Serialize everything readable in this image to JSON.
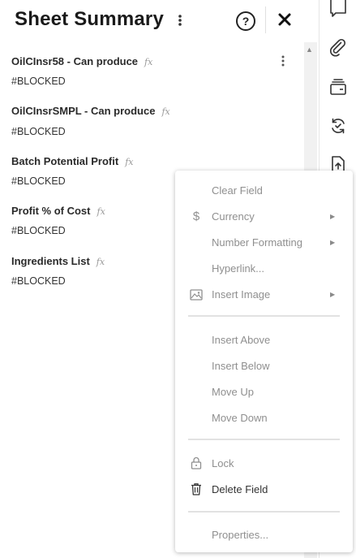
{
  "panel": {
    "title": "Sheet Summary",
    "help_glyph": "?",
    "fields": [
      {
        "label": "OilCInsr58 - Can produce",
        "value": "#BLOCKED",
        "fx": "fx"
      },
      {
        "label": "OilCInsrSMPL - Can produce",
        "value": "#BLOCKED",
        "fx": "fx"
      },
      {
        "label": "Batch Potential Profit",
        "value": "#BLOCKED",
        "fx": "fx"
      },
      {
        "label": "Profit % of Cost",
        "value": "#BLOCKED",
        "fx": "fx"
      },
      {
        "label": "Ingredients List",
        "value": "#BLOCKED",
        "fx": "fx"
      }
    ]
  },
  "rail": {
    "icons": [
      "comment-icon",
      "attachment-icon",
      "layers-icon",
      "sync-icon",
      "upload-icon"
    ]
  },
  "context_menu": {
    "items": {
      "clear_field": "Clear Field",
      "currency": "Currency",
      "number_formatting": "Number Formatting",
      "hyperlink": "Hyperlink...",
      "insert_image": "Insert Image",
      "insert_above": "Insert Above",
      "insert_below": "Insert Below",
      "move_up": "Move Up",
      "move_down": "Move Down",
      "lock": "Lock",
      "delete_field": "Delete Field",
      "properties": "Properties..."
    },
    "currency_glyph": "$"
  }
}
